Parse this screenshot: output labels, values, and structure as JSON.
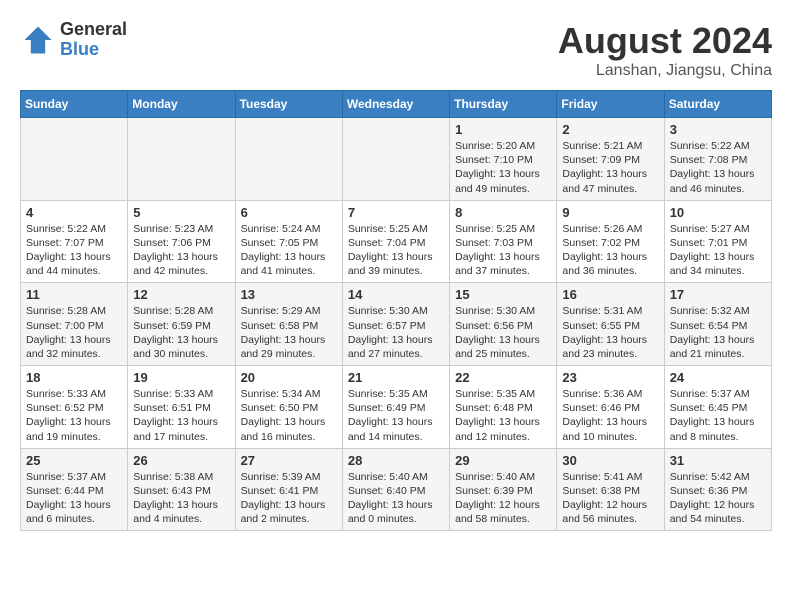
{
  "logo": {
    "text_general": "General",
    "text_blue": "Blue"
  },
  "title": "August 2024",
  "subtitle": "Lanshan, Jiangsu, China",
  "days_of_week": [
    "Sunday",
    "Monday",
    "Tuesday",
    "Wednesday",
    "Thursday",
    "Friday",
    "Saturday"
  ],
  "weeks": [
    [
      {
        "day": "",
        "info": ""
      },
      {
        "day": "",
        "info": ""
      },
      {
        "day": "",
        "info": ""
      },
      {
        "day": "",
        "info": ""
      },
      {
        "day": "1",
        "info": "Sunrise: 5:20 AM\nSunset: 7:10 PM\nDaylight: 13 hours\nand 49 minutes."
      },
      {
        "day": "2",
        "info": "Sunrise: 5:21 AM\nSunset: 7:09 PM\nDaylight: 13 hours\nand 47 minutes."
      },
      {
        "day": "3",
        "info": "Sunrise: 5:22 AM\nSunset: 7:08 PM\nDaylight: 13 hours\nand 46 minutes."
      }
    ],
    [
      {
        "day": "4",
        "info": "Sunrise: 5:22 AM\nSunset: 7:07 PM\nDaylight: 13 hours\nand 44 minutes."
      },
      {
        "day": "5",
        "info": "Sunrise: 5:23 AM\nSunset: 7:06 PM\nDaylight: 13 hours\nand 42 minutes."
      },
      {
        "day": "6",
        "info": "Sunrise: 5:24 AM\nSunset: 7:05 PM\nDaylight: 13 hours\nand 41 minutes."
      },
      {
        "day": "7",
        "info": "Sunrise: 5:25 AM\nSunset: 7:04 PM\nDaylight: 13 hours\nand 39 minutes."
      },
      {
        "day": "8",
        "info": "Sunrise: 5:25 AM\nSunset: 7:03 PM\nDaylight: 13 hours\nand 37 minutes."
      },
      {
        "day": "9",
        "info": "Sunrise: 5:26 AM\nSunset: 7:02 PM\nDaylight: 13 hours\nand 36 minutes."
      },
      {
        "day": "10",
        "info": "Sunrise: 5:27 AM\nSunset: 7:01 PM\nDaylight: 13 hours\nand 34 minutes."
      }
    ],
    [
      {
        "day": "11",
        "info": "Sunrise: 5:28 AM\nSunset: 7:00 PM\nDaylight: 13 hours\nand 32 minutes."
      },
      {
        "day": "12",
        "info": "Sunrise: 5:28 AM\nSunset: 6:59 PM\nDaylight: 13 hours\nand 30 minutes."
      },
      {
        "day": "13",
        "info": "Sunrise: 5:29 AM\nSunset: 6:58 PM\nDaylight: 13 hours\nand 29 minutes."
      },
      {
        "day": "14",
        "info": "Sunrise: 5:30 AM\nSunset: 6:57 PM\nDaylight: 13 hours\nand 27 minutes."
      },
      {
        "day": "15",
        "info": "Sunrise: 5:30 AM\nSunset: 6:56 PM\nDaylight: 13 hours\nand 25 minutes."
      },
      {
        "day": "16",
        "info": "Sunrise: 5:31 AM\nSunset: 6:55 PM\nDaylight: 13 hours\nand 23 minutes."
      },
      {
        "day": "17",
        "info": "Sunrise: 5:32 AM\nSunset: 6:54 PM\nDaylight: 13 hours\nand 21 minutes."
      }
    ],
    [
      {
        "day": "18",
        "info": "Sunrise: 5:33 AM\nSunset: 6:52 PM\nDaylight: 13 hours\nand 19 minutes."
      },
      {
        "day": "19",
        "info": "Sunrise: 5:33 AM\nSunset: 6:51 PM\nDaylight: 13 hours\nand 17 minutes."
      },
      {
        "day": "20",
        "info": "Sunrise: 5:34 AM\nSunset: 6:50 PM\nDaylight: 13 hours\nand 16 minutes."
      },
      {
        "day": "21",
        "info": "Sunrise: 5:35 AM\nSunset: 6:49 PM\nDaylight: 13 hours\nand 14 minutes."
      },
      {
        "day": "22",
        "info": "Sunrise: 5:35 AM\nSunset: 6:48 PM\nDaylight: 13 hours\nand 12 minutes."
      },
      {
        "day": "23",
        "info": "Sunrise: 5:36 AM\nSunset: 6:46 PM\nDaylight: 13 hours\nand 10 minutes."
      },
      {
        "day": "24",
        "info": "Sunrise: 5:37 AM\nSunset: 6:45 PM\nDaylight: 13 hours\nand 8 minutes."
      }
    ],
    [
      {
        "day": "25",
        "info": "Sunrise: 5:37 AM\nSunset: 6:44 PM\nDaylight: 13 hours\nand 6 minutes."
      },
      {
        "day": "26",
        "info": "Sunrise: 5:38 AM\nSunset: 6:43 PM\nDaylight: 13 hours\nand 4 minutes."
      },
      {
        "day": "27",
        "info": "Sunrise: 5:39 AM\nSunset: 6:41 PM\nDaylight: 13 hours\nand 2 minutes."
      },
      {
        "day": "28",
        "info": "Sunrise: 5:40 AM\nSunset: 6:40 PM\nDaylight: 13 hours\nand 0 minutes."
      },
      {
        "day": "29",
        "info": "Sunrise: 5:40 AM\nSunset: 6:39 PM\nDaylight: 12 hours\nand 58 minutes."
      },
      {
        "day": "30",
        "info": "Sunrise: 5:41 AM\nSunset: 6:38 PM\nDaylight: 12 hours\nand 56 minutes."
      },
      {
        "day": "31",
        "info": "Sunrise: 5:42 AM\nSunset: 6:36 PM\nDaylight: 12 hours\nand 54 minutes."
      }
    ]
  ]
}
